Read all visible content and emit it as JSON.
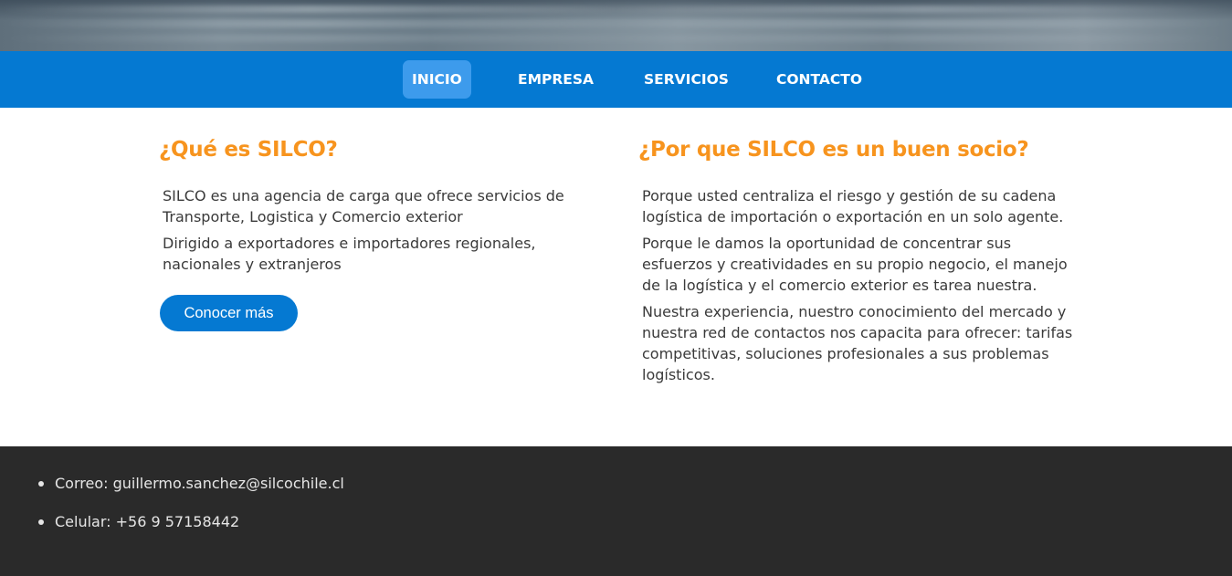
{
  "nav": {
    "items": [
      {
        "label": "INICIO",
        "active": true
      },
      {
        "label": "EMPRESA",
        "active": false
      },
      {
        "label": "SERVICIOS",
        "active": false
      },
      {
        "label": "CONTACTO",
        "active": false
      }
    ]
  },
  "about": {
    "title": "¿Qué es SILCO?",
    "paragraphs": [
      "SILCO es una agencia de carga que ofrece servicios de Transporte, Logistica y Comercio exterior",
      "Dirigido a exportadores e importadores regionales, nacionales y extranjeros"
    ],
    "button_label": "Conocer más"
  },
  "partner": {
    "title": "¿Por que SILCO es un buen socio?",
    "paragraphs": [
      "Porque usted centraliza el riesgo y gestión de su cadena logística de importación o exportación en un solo agente.",
      "Porque le damos la oportunidad de concentrar sus esfuerzos y creatividades en su propio negocio, el manejo de la logística y el comercio exterior es tarea nuestra.",
      "Nuestra experiencia, nuestro conocimiento del mercado y nuestra red de contactos nos capacita para ofrecer: tarifas competitivas, soluciones profesionales a sus problemas logísticos."
    ]
  },
  "footer": {
    "contacts": [
      "Correo: guillermo.sanchez@silcochile.cl",
      "Celular: +56 9 57158442"
    ]
  },
  "colors": {
    "primary": "#0579d2",
    "active_tab": "#3d9bec",
    "heading": "#f7941e",
    "footer_bg": "#2a2a2a"
  }
}
